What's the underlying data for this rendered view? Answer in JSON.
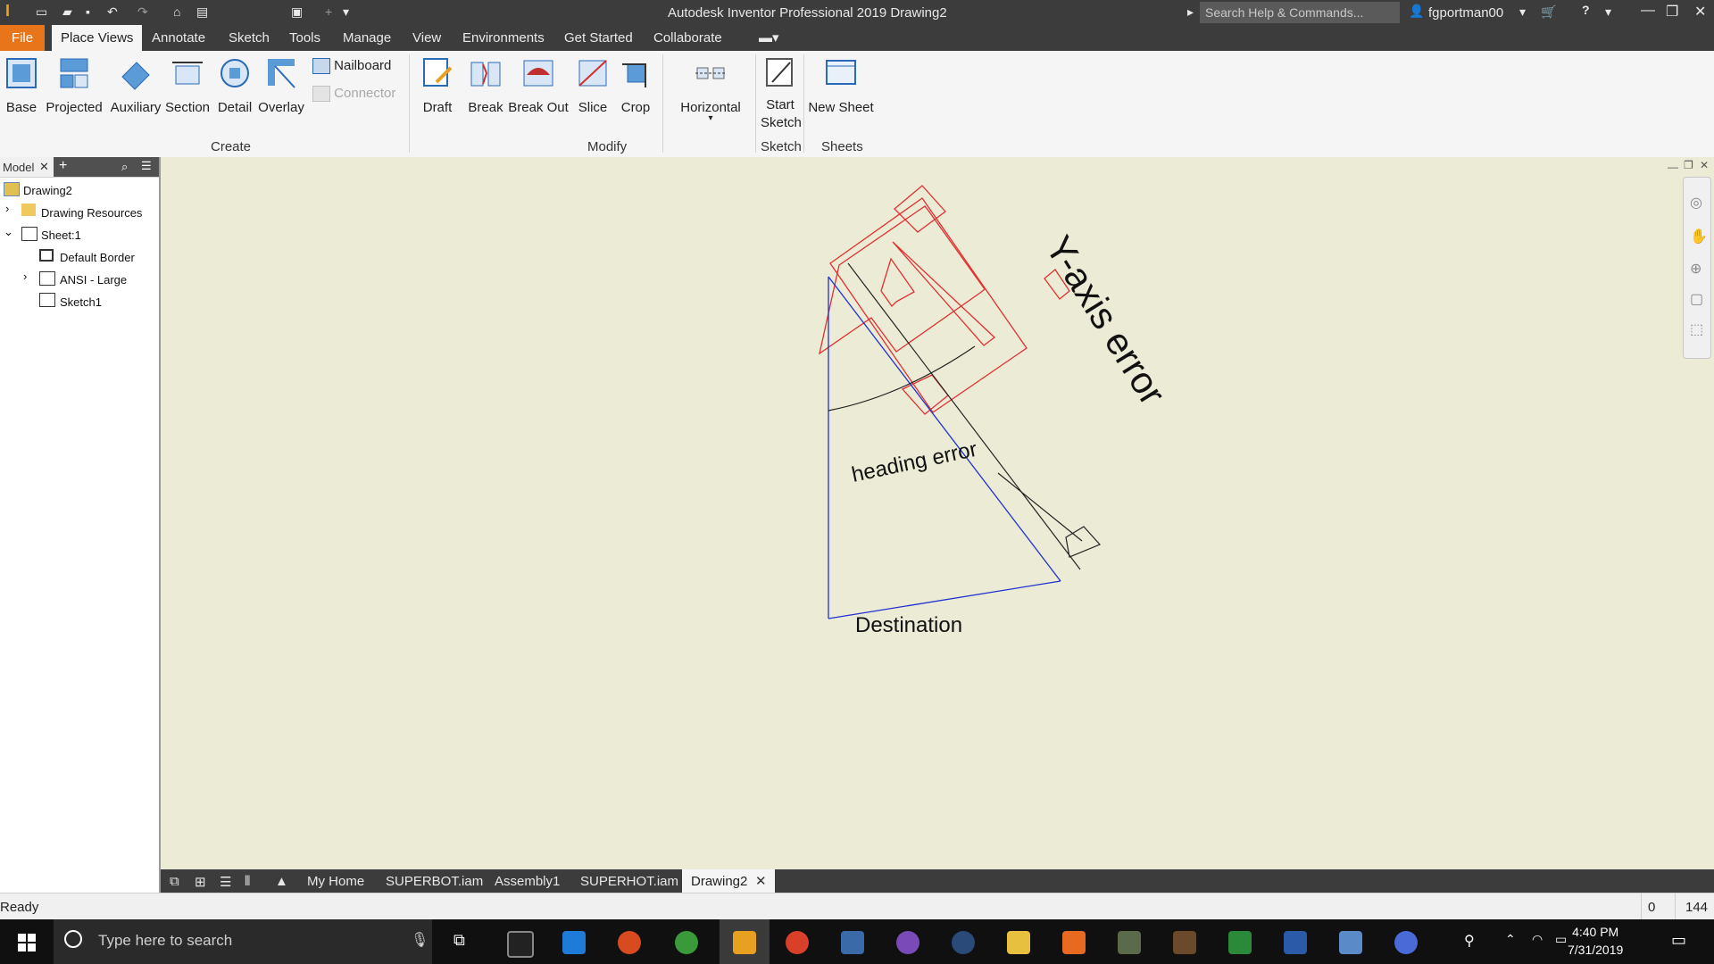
{
  "app": {
    "title": "Autodesk Inventor Professional 2019    Drawing2",
    "search_placeholder": "Search Help & Commands...",
    "user": "fgportman00"
  },
  "tabs": [
    "File",
    "Place Views",
    "Annotate",
    "Sketch",
    "Tools",
    "Manage",
    "View",
    "Environments",
    "Get Started",
    "Collaborate"
  ],
  "ribbon": {
    "create": {
      "group_label": "Create",
      "buttons": [
        "Base",
        "Projected",
        "Auxiliary",
        "Section",
        "Detail",
        "Overlay"
      ],
      "nailboard": "Nailboard",
      "connector": "Connector"
    },
    "modify": {
      "group_label": "Modify",
      "buttons": [
        "Draft",
        "Break",
        "Break Out",
        "Slice",
        "Crop"
      ],
      "horizontal": "Horizontal"
    },
    "sketch": {
      "group_label": "Sketch",
      "start_sketch_1": "Start",
      "start_sketch_2": "Sketch"
    },
    "sheets": {
      "group_label": "Sheets",
      "new_sheet": "New Sheet"
    }
  },
  "browser": {
    "tab": "Model",
    "items": [
      "Drawing2",
      "Drawing Resources",
      "Sheet:1",
      "Default Border",
      "ANSI - Large",
      "Sketch1"
    ]
  },
  "drawing": {
    "label_y_axis": "Y-axis error",
    "label_heading": "heading error",
    "label_destination": "Destination",
    "colors": {
      "robot": "#e03030",
      "path": "#2030d0",
      "lines": "#222222"
    }
  },
  "doc_tabs": [
    "My Home",
    "SUPERBOT.iam",
    "Assembly1",
    "SUPERHOT.iam",
    "Drawing2"
  ],
  "status": {
    "text": "Ready",
    "value_a": "0",
    "value_b": "144"
  },
  "taskbar": {
    "search_placeholder": "Type here to search",
    "time": "4:40 PM",
    "date": "7/31/2019"
  }
}
